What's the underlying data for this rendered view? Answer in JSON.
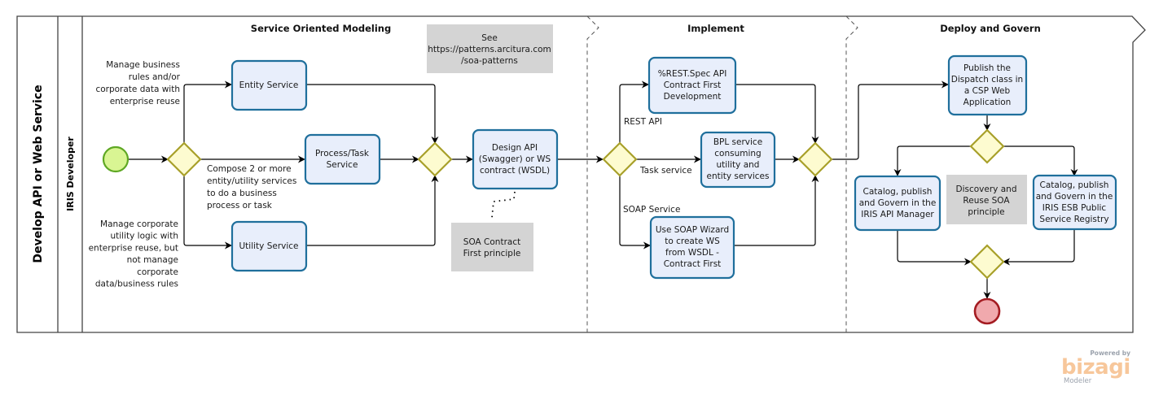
{
  "pool": {
    "title": "Develop API or Web Service"
  },
  "lane": {
    "title": "IRIS Developer"
  },
  "phases": [
    {
      "title": "Service Oriented Modeling"
    },
    {
      "title": "Implement"
    },
    {
      "title": "Deploy and Govern"
    }
  ],
  "tasks": {
    "entity_service": [
      "Entity Service"
    ],
    "process_task_service": [
      "Process/Task",
      "Service"
    ],
    "utility_service": [
      "Utility Service"
    ],
    "design_api": [
      "Design API",
      "(Swagger) or WS",
      "contract (WSDL)"
    ],
    "rest_spec": [
      "%REST.Spec API",
      "Contract First",
      "Development"
    ],
    "bpl_service": [
      "BPL service",
      "consuming",
      "utility and",
      "entity services"
    ],
    "soap_wizard": [
      "Use SOAP Wizard",
      "to  create WS",
      "from WSDL -",
      "Contract First"
    ],
    "publish_dispatch": [
      "Publish the",
      "Dispatch class in",
      "a CSP Web",
      "Application"
    ],
    "catalog_api_manager": [
      "Catalog, publish",
      "and Govern in the",
      "IRIS API Manager"
    ],
    "catalog_esb_registry": [
      "Catalog, publish",
      "and Govern in the",
      "IRIS ESB Public",
      "Service Registry"
    ]
  },
  "flow_labels": {
    "to_entity": [
      "Manage business",
      "rules and/or",
      "corporate data with",
      "enterprise reuse"
    ],
    "to_process": [
      "Compose 2 or more",
      "entity/utility services",
      "to do a business",
      "process or task"
    ],
    "to_utility": [
      "Manage corporate",
      "utility logic with",
      "enterprise reuse, but",
      "not manage",
      "corporate",
      "data/business rules"
    ],
    "rest_api": [
      "REST API"
    ],
    "task_service": [
      "Task service"
    ],
    "soap_service": [
      "SOAP Service"
    ]
  },
  "annotations": {
    "see_patterns": [
      "See",
      "https://patterns.arcitura.com",
      "/soa-patterns"
    ],
    "soa_contract": [
      "SOA Contract",
      "First principle"
    ],
    "discovery_reuse": [
      "Discovery and",
      "Reuse SOA",
      "principle"
    ]
  },
  "branding": {
    "powered_by": "Powered by",
    "name": "bizagi",
    "product": "Modeler"
  },
  "colors": {
    "task_fill": "#e8eefb",
    "task_stroke": "#1f6f9c",
    "gateway_fill": "#fdfbd0",
    "gateway_stroke": "#a8a02a",
    "start_fill": "#d9f593",
    "start_stroke": "#5fa824",
    "end_fill": "#f0a9ad",
    "end_stroke": "#a41c22",
    "annotation_fill": "#d4d4d4"
  }
}
